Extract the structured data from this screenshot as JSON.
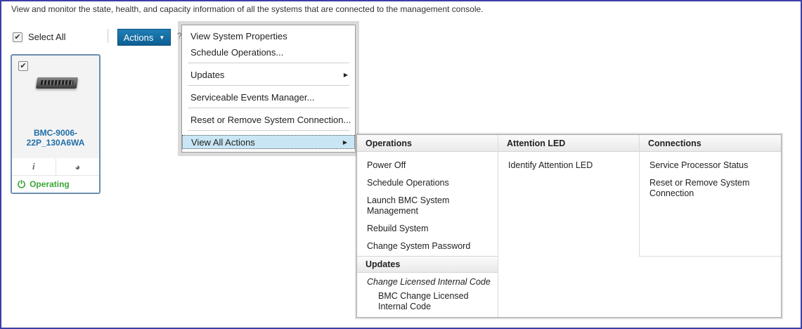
{
  "description": "View and monitor the state, health, and capacity information of all the systems that are connected to the management console.",
  "toolbar": {
    "select_all_label": "Select All",
    "select_all_check": "✔",
    "actions_label": "Actions",
    "actions_caret": "▼",
    "peek_text": "?"
  },
  "system_card": {
    "check": "✔",
    "name": "BMC-9006-22P_130A6WA",
    "info_icon": "i",
    "capacity_icon": "◕",
    "power_icon": "⏻",
    "status": "Operating"
  },
  "actions_menu": {
    "items": [
      {
        "label": "View System Properties"
      },
      {
        "label": "Schedule Operations..."
      },
      {
        "label": "Updates",
        "arrow": "▶"
      },
      {
        "label": "Serviceable Events Manager..."
      },
      {
        "label": "Reset or Remove System Connection..."
      },
      {
        "label": "View All Actions",
        "arrow": "▶"
      }
    ]
  },
  "all_actions": {
    "operations": {
      "heading": "Operations",
      "items": [
        "Power Off",
        "Schedule Operations",
        "Launch BMC System Management",
        "Rebuild System",
        "Change System Password"
      ]
    },
    "updates": {
      "heading": "Updates",
      "group": "Change Licensed Internal Code",
      "items": [
        "BMC Change Licensed Internal Code"
      ]
    },
    "attention_led": {
      "heading": "Attention LED",
      "items": [
        "Identify Attention LED"
      ]
    },
    "connections": {
      "heading": "Connections",
      "items": [
        "Service Processor Status",
        "Reset or Remove System Connection"
      ]
    }
  },
  "colors": {
    "accent": "#1f7fb6",
    "status_green": "#3aa635",
    "menu_highlight": "#c9e6f5",
    "frame_border": "#3b3fa8"
  }
}
